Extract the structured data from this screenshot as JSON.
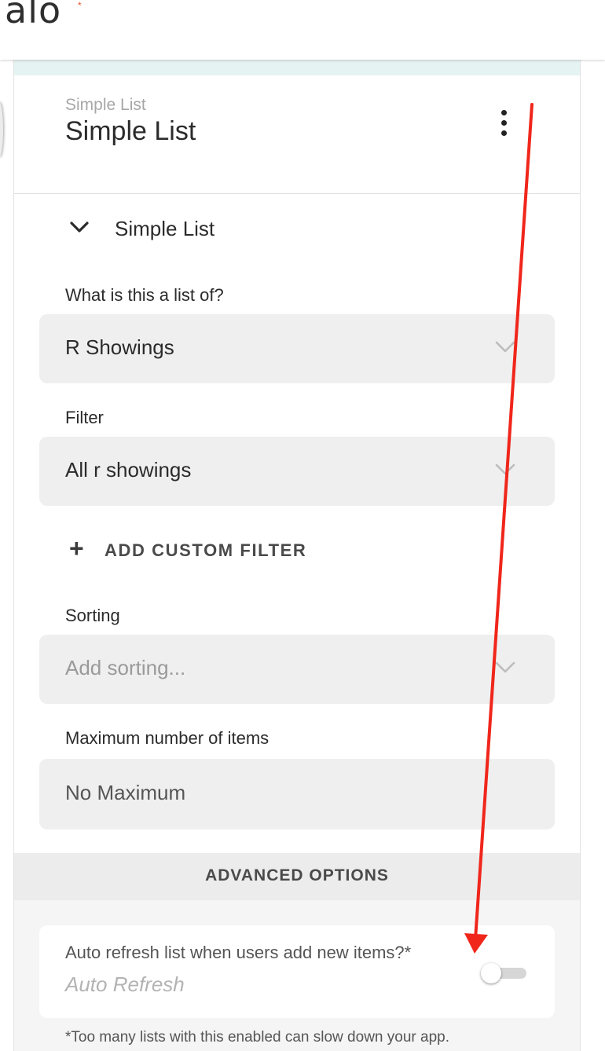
{
  "app": {
    "logo_text": "alo",
    "logo_mark": "*"
  },
  "header": {
    "subtitle": "Simple List",
    "title": "Simple List",
    "menu_icon": "kebab-menu-icon"
  },
  "section": {
    "title": "Simple List",
    "toggle_icon": "chevron-down-icon"
  },
  "fields": {
    "list_of": {
      "label": "What is this a list of?",
      "value": "R Showings"
    },
    "filter": {
      "label": "Filter",
      "value": "All r showings"
    },
    "add_filter": {
      "label": "ADD CUSTOM FILTER",
      "icon": "plus-icon"
    },
    "sorting": {
      "label": "Sorting",
      "placeholder": "Add sorting..."
    },
    "max_items": {
      "label": "Maximum number of items",
      "value": "No Maximum"
    }
  },
  "advanced": {
    "title": "ADVANCED OPTIONS",
    "auto_refresh": {
      "label": "Auto refresh list when users add new items?*",
      "sublabel": "Auto Refresh",
      "enabled": false
    },
    "footnote": "*Too many lists with this enabled can slow down your app."
  },
  "colors": {
    "logo_accent": "#e8532f",
    "annotation_arrow": "#f0261b",
    "header_strip": "#e5f3f2"
  }
}
